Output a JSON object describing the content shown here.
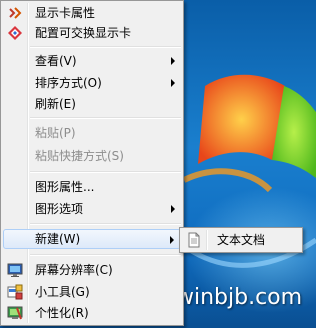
{
  "context_menu": {
    "items": [
      {
        "label": "显示卡属性",
        "icon": "graphics-card-icon",
        "disabled": false,
        "has_submenu": false
      },
      {
        "label": "配置可交换显示卡",
        "icon": "switchable-graphics-icon",
        "disabled": false,
        "has_submenu": false
      },
      {
        "label": "查看(V)",
        "icon": "",
        "disabled": false,
        "has_submenu": true
      },
      {
        "label": "排序方式(O)",
        "icon": "",
        "disabled": false,
        "has_submenu": true
      },
      {
        "label": "刷新(E)",
        "icon": "",
        "disabled": false,
        "has_submenu": false
      },
      {
        "label": "粘贴(P)",
        "icon": "",
        "disabled": true,
        "has_submenu": false
      },
      {
        "label": "粘贴快捷方式(S)",
        "icon": "",
        "disabled": true,
        "has_submenu": false
      },
      {
        "label": "图形属性...",
        "icon": "",
        "disabled": false,
        "has_submenu": false
      },
      {
        "label": "图形选项",
        "icon": "",
        "disabled": false,
        "has_submenu": true
      },
      {
        "label": "新建(W)",
        "icon": "",
        "disabled": false,
        "has_submenu": true,
        "highlighted": true
      },
      {
        "label": "屏幕分辨率(C)",
        "icon": "screen-resolution-icon",
        "disabled": false,
        "has_submenu": false
      },
      {
        "label": "小工具(G)",
        "icon": "gadgets-icon",
        "disabled": false,
        "has_submenu": false
      },
      {
        "label": "个性化(R)",
        "icon": "personalize-icon",
        "disabled": false,
        "has_submenu": false
      }
    ]
  },
  "submenu_new": {
    "items": [
      {
        "label": "文本文档",
        "icon": "text-document-icon"
      }
    ]
  },
  "watermark": {
    "text": "winbjb.com"
  },
  "colors": {
    "menu_background": "#f0f0f0",
    "menu_border": "#979797",
    "highlight_border": "#aecff7",
    "disabled_text": "#8d8d8d",
    "desktop_blue": "#1a7fce"
  }
}
